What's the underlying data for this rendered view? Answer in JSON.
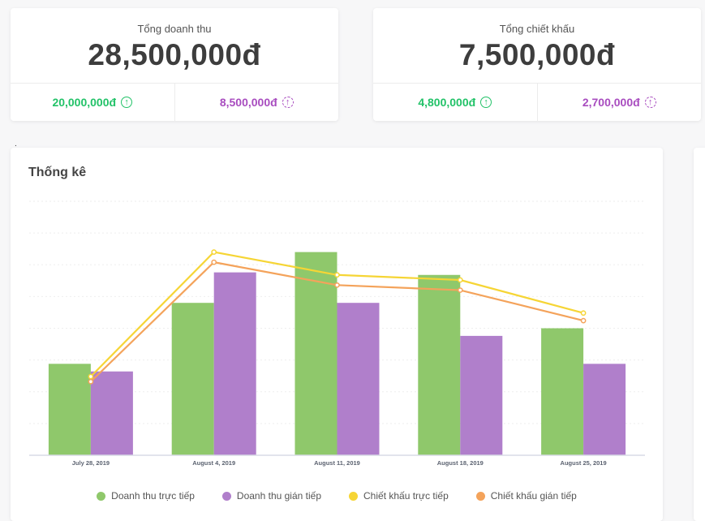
{
  "summary_cards": [
    {
      "label": "Tổng doanh thu",
      "value": "28,500,000đ",
      "direct": "20,000,000đ",
      "indirect": "8,500,000đ"
    },
    {
      "label": "Tổng chiết khấu",
      "value": "7,500,000đ",
      "direct": "4,800,000đ",
      "indirect": "2,700,000đ"
    }
  ],
  "icons": {
    "direct": "arrow-up-circle-icon",
    "indirect": "arrow-up-dashed-circle-icon",
    "arrow_glyph": "↑"
  },
  "colors": {
    "direct_text": "#22c268",
    "indirect_text": "#a84cbf",
    "bar_direct": "#8fc86b",
    "bar_indirect": "#b07fcb",
    "line_direct": "#f6d535",
    "line_indirect": "#f4a35b"
  },
  "stray_mark": ".",
  "chart_section_title": "Thống kê",
  "chart_data": {
    "type": "bar",
    "categories": [
      "July 28, 2019",
      "August 4, 2019",
      "August 11, 2019",
      "August 18, 2019",
      "August 25, 2019"
    ],
    "ylim": [
      0,
      100
    ],
    "grid": true,
    "series": [
      {
        "name": "Doanh thu trực tiếp",
        "kind": "bar",
        "color": "#8fc86b",
        "values": [
          36,
          60,
          80,
          71,
          50
        ]
      },
      {
        "name": "Doanh thu gián tiếp",
        "kind": "bar",
        "color": "#b07fcb",
        "values": [
          33,
          72,
          60,
          47,
          36
        ]
      },
      {
        "name": "Chiết khấu trực tiếp",
        "kind": "line",
        "color": "#f6d535",
        "values": [
          31,
          80,
          71,
          69,
          56
        ]
      },
      {
        "name": "Chiết khấu gián tiếp",
        "kind": "line",
        "color": "#f4a35b",
        "values": [
          29,
          76,
          67,
          65,
          53
        ]
      }
    ],
    "legend_position": "bottom"
  }
}
